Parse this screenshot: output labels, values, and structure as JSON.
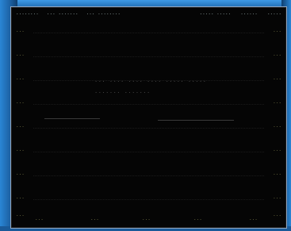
{
  "desktop": {
    "background": "#1e6fb8"
  },
  "window": {
    "title_left": [
      "........",
      "... .......",
      "... ........"
    ],
    "title_right": [
      "..... .....",
      "......",
      "....."
    ]
  },
  "panel": {
    "y_left": [
      "...",
      "...",
      "...",
      "...",
      "...",
      "...",
      "...",
      "...",
      "..."
    ],
    "y_right": [
      "...",
      "...",
      "...",
      "...",
      "...",
      "...",
      "...",
      "...",
      "..."
    ],
    "heading_1": "... .... .... .... ..... .....",
    "heading_2": "....... .......",
    "x_labels": [
      "...",
      "...",
      "...",
      "...",
      "..."
    ]
  }
}
